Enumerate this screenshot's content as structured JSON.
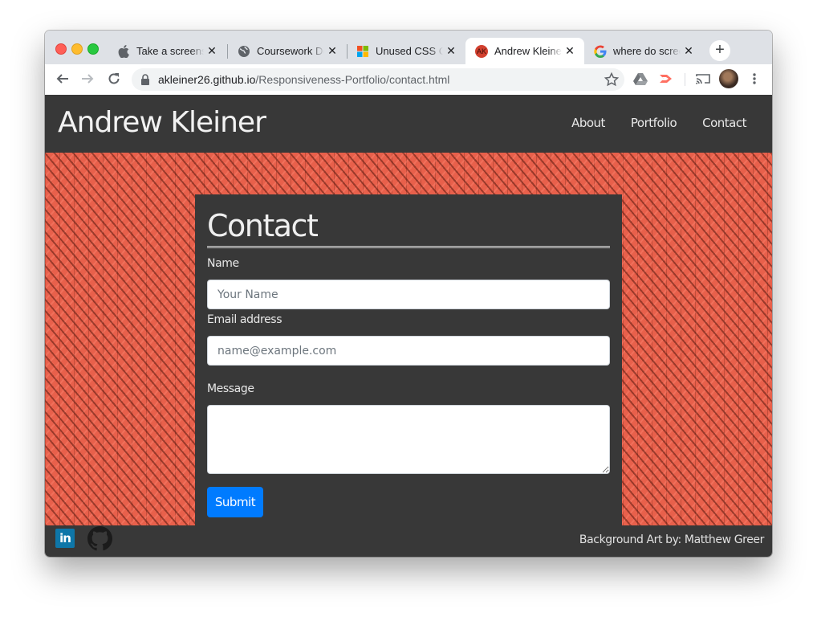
{
  "browser": {
    "tabs": [
      {
        "title": "Take a screenshot on your Mac",
        "favicon": "apple-icon",
        "active": false
      },
      {
        "title": "Coursework Deadlines",
        "favicon": "globe-icon",
        "active": false
      },
      {
        "title": "Unused CSS Classes",
        "favicon": "microsoft-icon",
        "active": false
      },
      {
        "title": "Andrew Kleiner",
        "favicon": "ak-avatar-icon",
        "favicon_text": "AK",
        "active": true
      },
      {
        "title": "where do screenshots go mac",
        "favicon": "google-icon",
        "active": false
      }
    ],
    "close_glyph": "✕",
    "new_tab_glyph": "+",
    "url_host": "akleiner26.github.io",
    "url_path": "/Responsiveness-Portfolio/contact.html"
  },
  "site": {
    "brand": "Andrew Kleiner",
    "nav": [
      "About",
      "Portfolio",
      "Contact"
    ]
  },
  "contact": {
    "heading": "Contact",
    "name_label": "Name",
    "name_placeholder": "Your Name",
    "email_label": "Email address",
    "email_placeholder": "name@example.com",
    "message_label": "Message",
    "submit_label": "Submit"
  },
  "footer": {
    "linkedin_text": "in",
    "credit": "Background Art by: Matthew Greer"
  },
  "colors": {
    "navbar": "#383838",
    "background_art": "#e8604b",
    "submit": "#007bff"
  }
}
